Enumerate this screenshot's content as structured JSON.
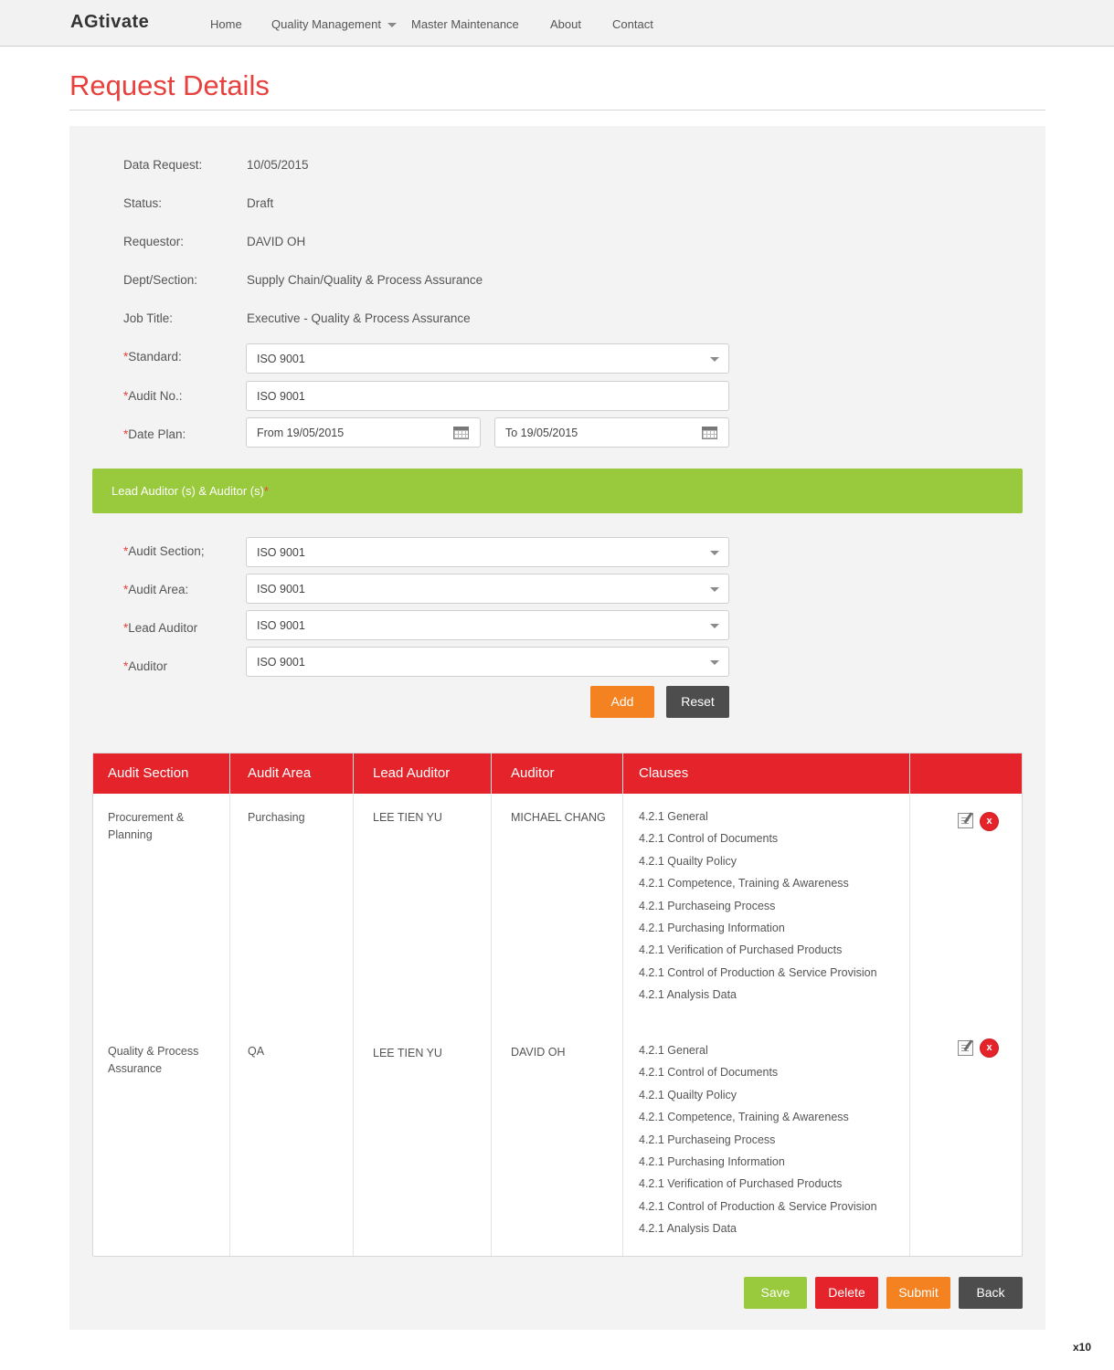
{
  "nav": {
    "brand": "AGtivate",
    "items": [
      "Home",
      "Quality Management",
      "Master Maintenance",
      "About",
      "Contact"
    ]
  },
  "page": {
    "title": "Request Details"
  },
  "details": {
    "data_request_label": "Data Request:",
    "data_request": "10/05/2015",
    "status_label": "Status:",
    "status": "Draft",
    "requestor_label": "Requestor:",
    "requestor": "DAVID OH",
    "dept_label": "Dept/Section:",
    "dept": "Supply Chain/Quality & Process Assurance",
    "job_title_label": "Job Title:",
    "job_title": "Executive - Quality & Process Assurance"
  },
  "form": {
    "required_mark": "*",
    "standard_label": "Standard:",
    "standard_value": "ISO 9001",
    "audit_no_label": "Audit No.:",
    "audit_no_value": "ISO 9001",
    "date_plan_label": "Date Plan:",
    "date_from": "From  19/05/2015",
    "date_to": "To  19/05/2015"
  },
  "auditors_section": {
    "title": "Lead Auditor (s) & Auditor (s)",
    "required_mark": "*",
    "audit_section_label": "Audit Section;",
    "audit_section_value": "ISO 9001",
    "audit_area_label": "Audit Area:",
    "audit_area_value": "ISO 9001",
    "lead_auditor_label": "Lead Auditor",
    "lead_auditor_value": "ISO 9001",
    "auditor_label": "Auditor",
    "auditor_value": "ISO 9001",
    "add_label": "Add",
    "reset_label": "Reset"
  },
  "table": {
    "headers": [
      "Audit Section",
      "Audit Area",
      "Lead Auditor",
      "Auditor",
      "Clauses",
      ""
    ],
    "rows": [
      {
        "audit_section": "Procurement & Planning",
        "audit_area": "Purchasing",
        "lead_auditor": "LEE TIEN YU",
        "auditor": "MICHAEL CHANG",
        "clauses": [
          "4.2.1 General",
          "4.2.1 Control of Documents",
          "4.2.1 Quailty Policy",
          "4.2.1 Competence, Training & Awareness",
          "4.2.1 Purchaseing Process",
          "4.2.1 Purchasing Information",
          "4.2.1 Verification of Purchased Products",
          "4.2.1 Control of Production & Service Provision",
          "4.2.1 Analysis Data"
        ]
      },
      {
        "audit_section": "Quality & Process Assurance",
        "audit_area": "QA",
        "lead_auditor": "LEE TIEN YU",
        "auditor": "DAVID OH",
        "clauses": [
          "4.2.1 General",
          "4.2.1 Control of Documents",
          "4.2.1 Quailty Policy",
          "4.2.1 Competence, Training & Awareness",
          "4.2.1 Purchaseing Process",
          "4.2.1 Purchasing Information",
          "4.2.1 Verification of Purchased Products",
          "4.2.1 Control of Production & Service Provision",
          "4.2.1 Analysis Data"
        ]
      }
    ],
    "delete_mark": "x"
  },
  "actions": {
    "save": "Save",
    "delete": "Delete",
    "submit": "Submit",
    "back": "Back"
  },
  "footnote": "x10",
  "colors": {
    "accent_red": "#e4232a",
    "title_red": "#e8413d",
    "green": "#99c93c",
    "orange": "#f58220",
    "dark": "#4d4d4d"
  }
}
